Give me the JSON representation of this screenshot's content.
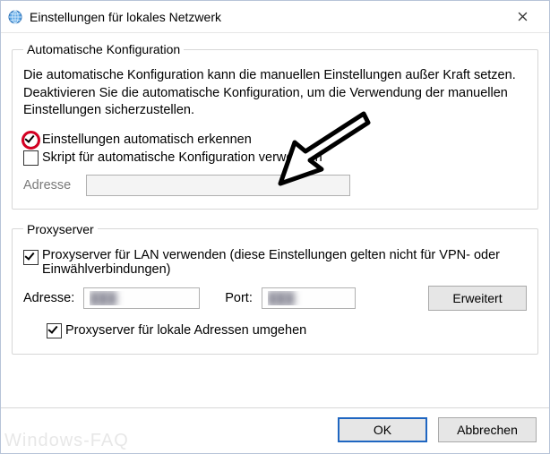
{
  "window": {
    "title": "Einstellungen für lokales Netzwerk"
  },
  "auto": {
    "legend": "Automatische Konfiguration",
    "desc": "Die automatische Konfiguration kann die manuellen Einstellungen außer Kraft setzen. Deaktivieren Sie die automatische Konfiguration, um die Verwendung der manuellen Einstellungen sicherzustellen.",
    "detect_label": "Einstellungen automatisch erkennen",
    "detect_checked": true,
    "script_label": "Skript für automatische Konfiguration verwenden",
    "script_checked": false,
    "address_label": "Adresse",
    "address_value": ""
  },
  "proxy": {
    "legend": "Proxyserver",
    "use_label": "Proxyserver für LAN verwenden (diese Einstellungen gelten nicht für VPN- oder Einwählverbindungen)",
    "use_checked": true,
    "address_label": "Adresse:",
    "address_value": "███",
    "port_label": "Port:",
    "port_value": "███",
    "advanced_label": "Erweitert",
    "bypass_label": "Proxyserver für lokale Adressen umgehen",
    "bypass_checked": true
  },
  "buttons": {
    "ok": "OK",
    "cancel": "Abbrechen"
  },
  "watermark": "Windows-FAQ"
}
